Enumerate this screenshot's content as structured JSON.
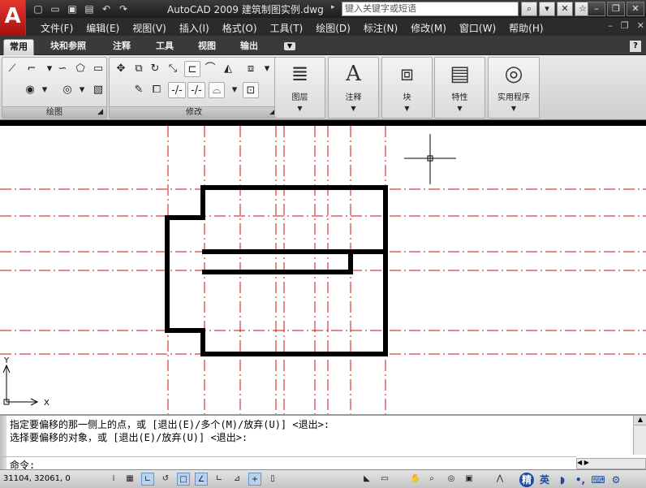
{
  "app": {
    "logo": "A",
    "title": "AutoCAD 2009 建筑制图实例.dwg"
  },
  "search": {
    "placeholder": "键入关键字或短语"
  },
  "menu": {
    "items": [
      "文件(F)",
      "编辑(E)",
      "视图(V)",
      "插入(I)",
      "格式(O)",
      "工具(T)",
      "绘图(D)",
      "标注(N)",
      "修改(M)",
      "窗口(W)",
      "帮助(H)"
    ]
  },
  "ribbon_tabs": {
    "items": [
      "常用",
      "块和参照",
      "注释",
      "工具",
      "视图",
      "输出"
    ],
    "active": "常用"
  },
  "panels": {
    "draw": "绘图",
    "modify": "修改",
    "layer": "图层",
    "annotate": "注释",
    "block": "块",
    "properties": "特性",
    "utilities": "实用程序"
  },
  "ucs": {
    "y": "Y",
    "x": "X"
  },
  "command": {
    "line1": "指定要偏移的那一侧上的点，或 [退出(E)/多个(M)/放弃(U)] <退出>:",
    "line2": "选择要偏移的对象，或 [退出(E)/放弃(U)] <退出>:",
    "prompt": "命令:"
  },
  "status": {
    "coords": "31104, 32061, 0"
  },
  "ime": {
    "jing": "精",
    "ying": "英"
  },
  "colors": {
    "centerline": "#cc1111",
    "geometry": "#000000"
  }
}
